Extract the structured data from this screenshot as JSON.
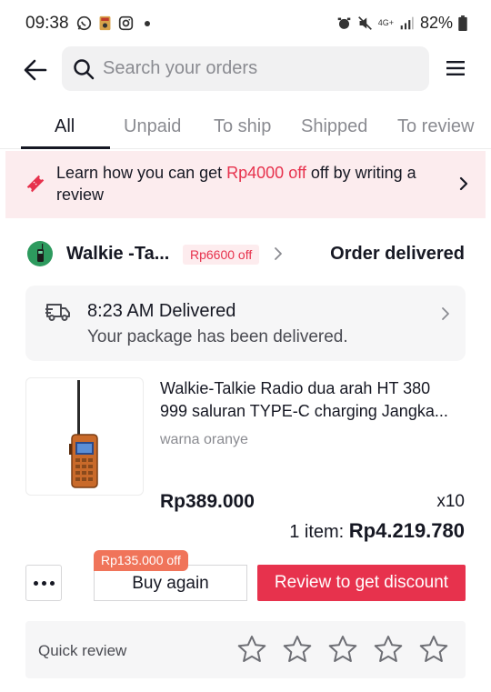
{
  "status_bar": {
    "time": "09:38",
    "network": "4G+",
    "battery": "82%"
  },
  "search": {
    "placeholder": "Search your orders"
  },
  "tabs": [
    {
      "label": "All",
      "active": true
    },
    {
      "label": "Unpaid",
      "active": false
    },
    {
      "label": "To ship",
      "active": false
    },
    {
      "label": "Shipped",
      "active": false
    },
    {
      "label": "To review",
      "active": false
    }
  ],
  "banner": {
    "text_before": "Learn how you can get ",
    "amount": "Rp4000 off",
    "text_after": " off by writing a review"
  },
  "order": {
    "shop_name": "Walkie -Ta...",
    "shop_discount": "Rp6600 off",
    "status": "Order delivered",
    "delivery": {
      "title": "8:23 AM Delivered",
      "subtitle": "Your package has been delivered."
    },
    "product": {
      "name": "Walkie-Talkie Radio dua arah HT 380 999 saluran TYPE-C charging Jangka...",
      "variant": "warna oranye",
      "price": "Rp389.000",
      "quantity": "x10"
    },
    "total_label": "1 item: ",
    "total_value": "Rp4.219.780"
  },
  "actions": {
    "buy_again_discount": "Rp135.000 off",
    "buy_again": "Buy again",
    "review": "Review to get discount"
  },
  "quick_review": {
    "label": "Quick review",
    "stars": 5
  },
  "colors": {
    "accent": "#e7324d",
    "banner_bg": "#fcecee",
    "tag_orange": "#f0745a"
  }
}
